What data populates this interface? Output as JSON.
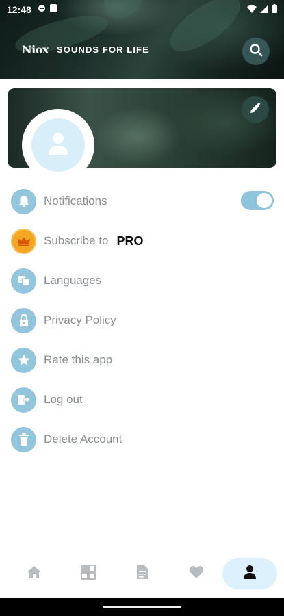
{
  "status_bar": {
    "time": "12:48"
  },
  "header": {
    "logo_text": "Niox",
    "tagline": "SOUNDS FOR LIFE"
  },
  "menu": {
    "notifications": {
      "label": "Notifications",
      "toggle_on": true
    },
    "subscribe": {
      "label": "Subscribe to",
      "badge": "PRO"
    },
    "languages": {
      "label": "Languages"
    },
    "privacy": {
      "label": "Privacy Policy"
    },
    "rate": {
      "label": "Rate this app"
    },
    "logout": {
      "label": "Log out"
    },
    "delete": {
      "label": "Delete Account"
    }
  },
  "bottom_nav": {
    "items": [
      {
        "icon": "home-icon"
      },
      {
        "icon": "grid-icon"
      },
      {
        "icon": "document-icon"
      },
      {
        "icon": "heart-icon"
      },
      {
        "icon": "person-icon",
        "active": true
      }
    ]
  },
  "colors": {
    "accent": "#93c5dc",
    "pro_icon": "#f5a623",
    "active_nav_bg": "#dcf1fb"
  }
}
